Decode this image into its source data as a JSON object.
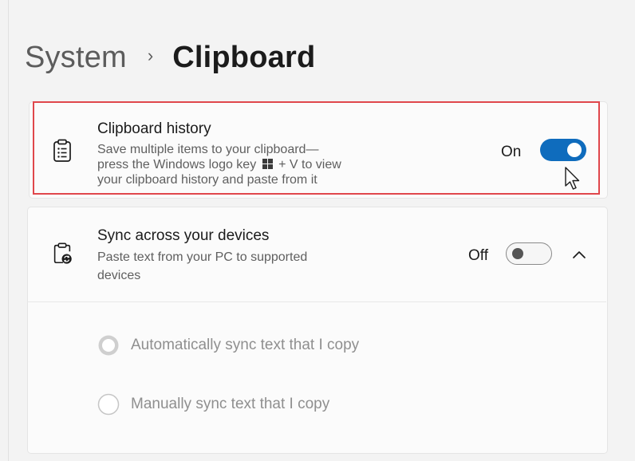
{
  "breadcrumb": {
    "parent": "System",
    "separator": "›",
    "current": "Clipboard"
  },
  "clipboard_history": {
    "title": "Clipboard history",
    "description_lines": [
      "Save multiple items to your clipboard—",
      "press the Windows logo key",
      "+ V to view",
      "your clipboard history and paste from it"
    ],
    "state_label": "On",
    "toggle_on": true,
    "icon": "clipboard-list-icon"
  },
  "sync": {
    "title": "Sync across your devices",
    "description_lines": [
      "Paste text from your PC to supported",
      "devices"
    ],
    "state_label": "Off",
    "toggle_on": false,
    "icon": "clipboard-sync-icon",
    "expand_icon": "chevron-up-icon",
    "options": [
      {
        "label": "Automatically sync text that I copy",
        "selected": true
      },
      {
        "label": "Manually sync text that I copy",
        "selected": false
      }
    ]
  },
  "colors": {
    "accent": "#0f6cbd",
    "highlight_border": "#e0474c",
    "disabled_text": "#8f8f8f"
  }
}
